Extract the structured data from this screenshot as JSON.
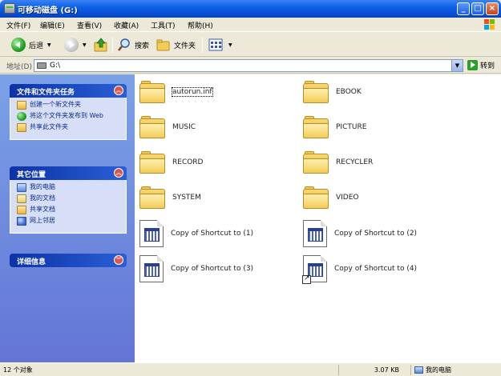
{
  "window": {
    "title": "可移动磁盘 (G:)",
    "buttons": {
      "minimize": "_",
      "maximize": "□",
      "close": "×"
    }
  },
  "menu": [
    "文件(F)",
    "编辑(E)",
    "查看(V)",
    "收藏(A)",
    "工具(T)",
    "帮助(H)"
  ],
  "toolbar": {
    "back": "后退",
    "search": "搜索",
    "folders": "文件夹"
  },
  "address": {
    "label": "地址(D)",
    "value": "G:\\",
    "go": "转到"
  },
  "taskpane": {
    "file_tasks": {
      "title": "文件和文件夹任务",
      "items": [
        {
          "label": "创建一个新文件夹",
          "icon": "new-folder-icon"
        },
        {
          "label": "将这个文件夹发布到 Web",
          "icon": "publish-web-icon"
        },
        {
          "label": "共享此文件夹",
          "icon": "share-folder-icon"
        }
      ]
    },
    "other_places": {
      "title": "其它位置",
      "items": [
        {
          "label": "我的电脑",
          "icon": "my-computer-icon"
        },
        {
          "label": "我的文档",
          "icon": "my-documents-icon"
        },
        {
          "label": "共享文档",
          "icon": "shared-documents-icon"
        },
        {
          "label": "网上邻居",
          "icon": "network-places-icon"
        }
      ]
    },
    "details": {
      "title": "详细信息"
    }
  },
  "files": [
    {
      "name": "autorun.inf",
      "type": "folder",
      "selected": true
    },
    {
      "name": "EBOOK",
      "type": "folder"
    },
    {
      "name": "MUSIC",
      "type": "folder"
    },
    {
      "name": "PICTURE",
      "type": "folder"
    },
    {
      "name": "RECORD",
      "type": "folder"
    },
    {
      "name": "RECYCLER",
      "type": "folder"
    },
    {
      "name": "SYSTEM",
      "type": "folder"
    },
    {
      "name": "VIDEO",
      "type": "folder"
    },
    {
      "name": "Copy of Shortcut to (1)",
      "type": "shortcut-doc"
    },
    {
      "name": "Copy of Shortcut to (2)",
      "type": "shortcut-doc"
    },
    {
      "name": "Copy of Shortcut to (3)",
      "type": "shortcut-doc"
    },
    {
      "name": "Copy of Shortcut to (4)",
      "type": "shortcut-doc",
      "arrow": true
    }
  ],
  "status": {
    "count": "12 个对象",
    "size": "3.07 KB",
    "location": "我的电脑"
  },
  "colors": {
    "titlebar": "#0a5fe6",
    "taskpane": "#6f8fe0",
    "panel_body": "#d6dff7",
    "folder": "#f3cc58"
  }
}
